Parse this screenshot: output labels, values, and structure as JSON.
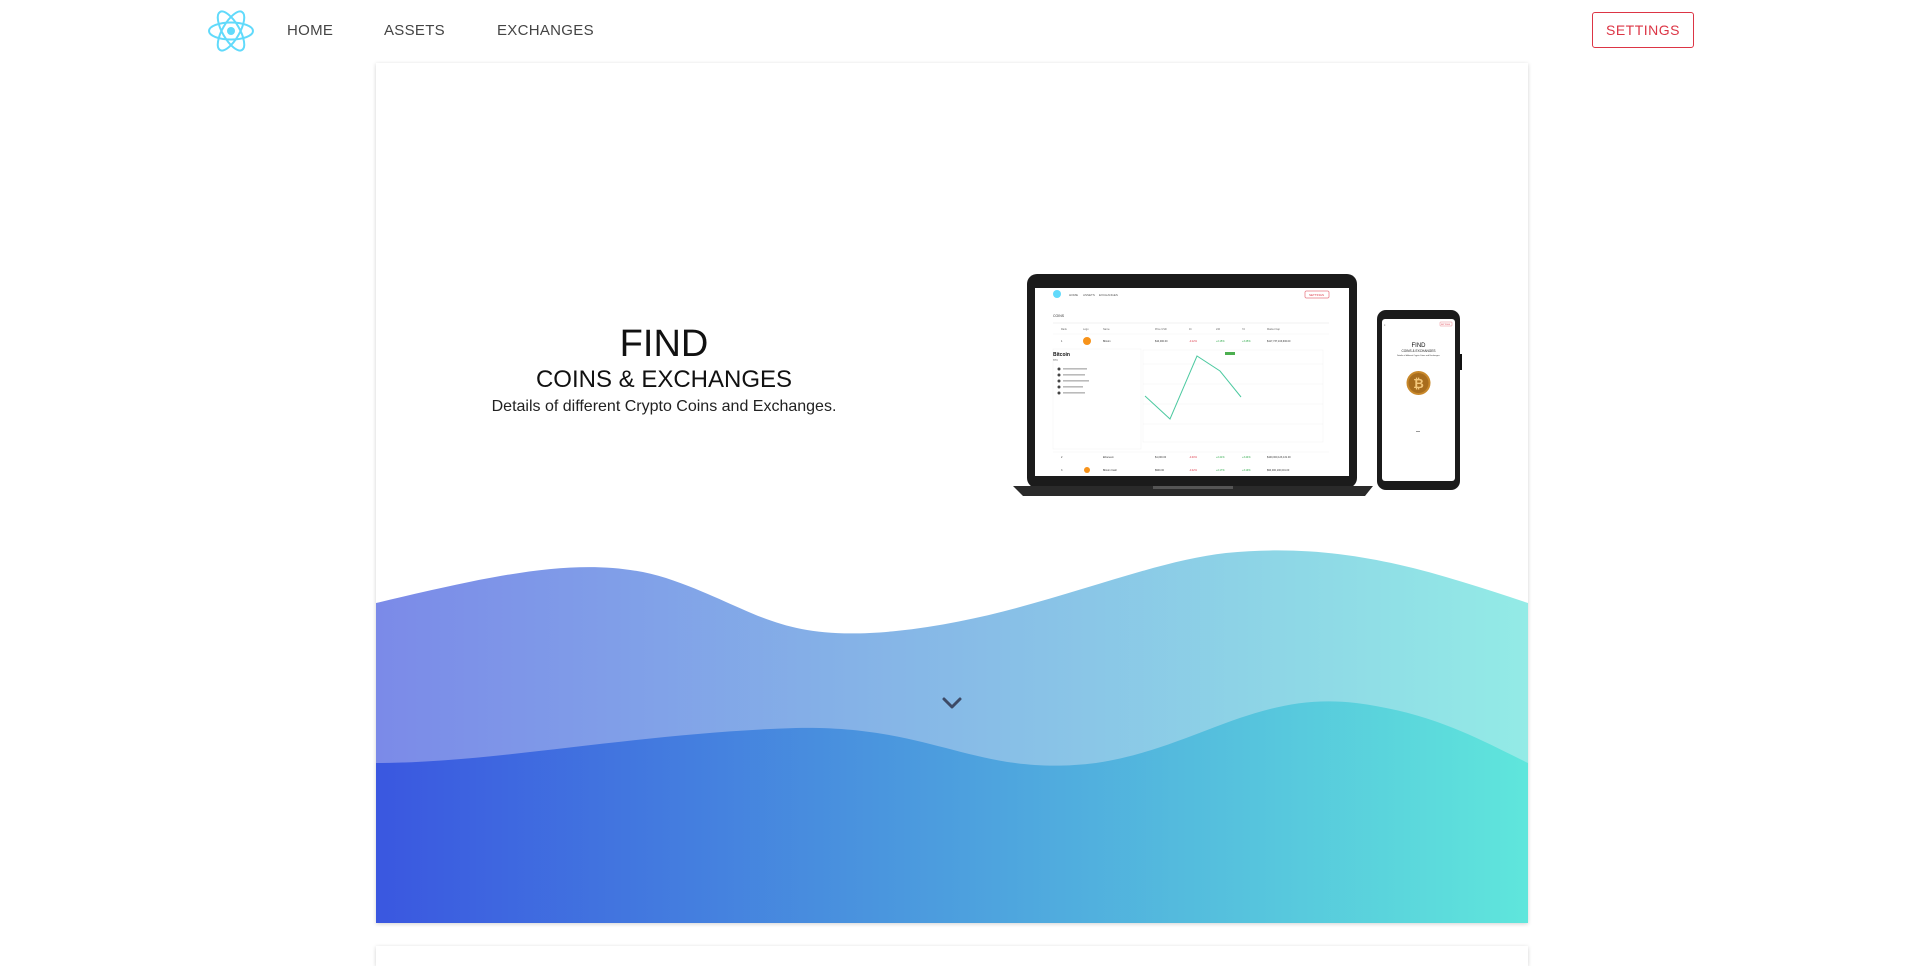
{
  "nav": {
    "logo_icon": "react-atom-icon",
    "links": [
      "HOME",
      "ASSETS",
      "EXCHANGES"
    ],
    "settings_label": "SETTINGS"
  },
  "hero": {
    "title": "FIND",
    "subtitle": "COINS & EXCHANGES",
    "description": "Details of different Crypto Coins and Exchanges.",
    "scroll_icon": "chevron-down-icon"
  },
  "mockup": {
    "laptop_screen": {
      "nav_links": [
        "HOME",
        "ASSETS",
        "EXCHANGES"
      ],
      "settings_label": "SETTINGS",
      "section_label": "COINS",
      "table_headers": [
        "Rank",
        "Logo",
        "Name",
        "Price USD",
        "1h",
        "24h",
        "7d",
        "Market Cap"
      ],
      "rows": [
        [
          "1",
          "",
          "Bitcoin",
          "$10,000.00",
          "-0.12%",
          "+2.15%",
          "+3.45%",
          "$117,737,103,600.00"
        ],
        [
          "2",
          "",
          "Ethereum",
          "$1,000.00",
          "-0.40%",
          "+2.41%",
          "+3.44%",
          "$100,000,123,131.00"
        ],
        [
          "3",
          "",
          "Bitcoin Cash",
          "$900.00",
          "-0.42%",
          "+2.17%",
          "+3.19%",
          "$90,000,100,001.00"
        ]
      ],
      "detail_title": "Bitcoin",
      "detail_symbol": "BTC"
    },
    "phone_screen": {
      "settings_label": "SETTINGS",
      "title": "FIND",
      "subtitle": "COINS & EXCHANGES",
      "description": "Details of different Crypto Coins and Exchanges.",
      "coin_glyph": "₿"
    }
  },
  "colors": {
    "accent": "#dc3545",
    "logo": "#61dafb",
    "wave_back_start": "#7b8ae8",
    "wave_back_end": "#93ebe6",
    "wave_front_start": "#3a57e0",
    "wave_front_end": "#5fe6dc"
  }
}
